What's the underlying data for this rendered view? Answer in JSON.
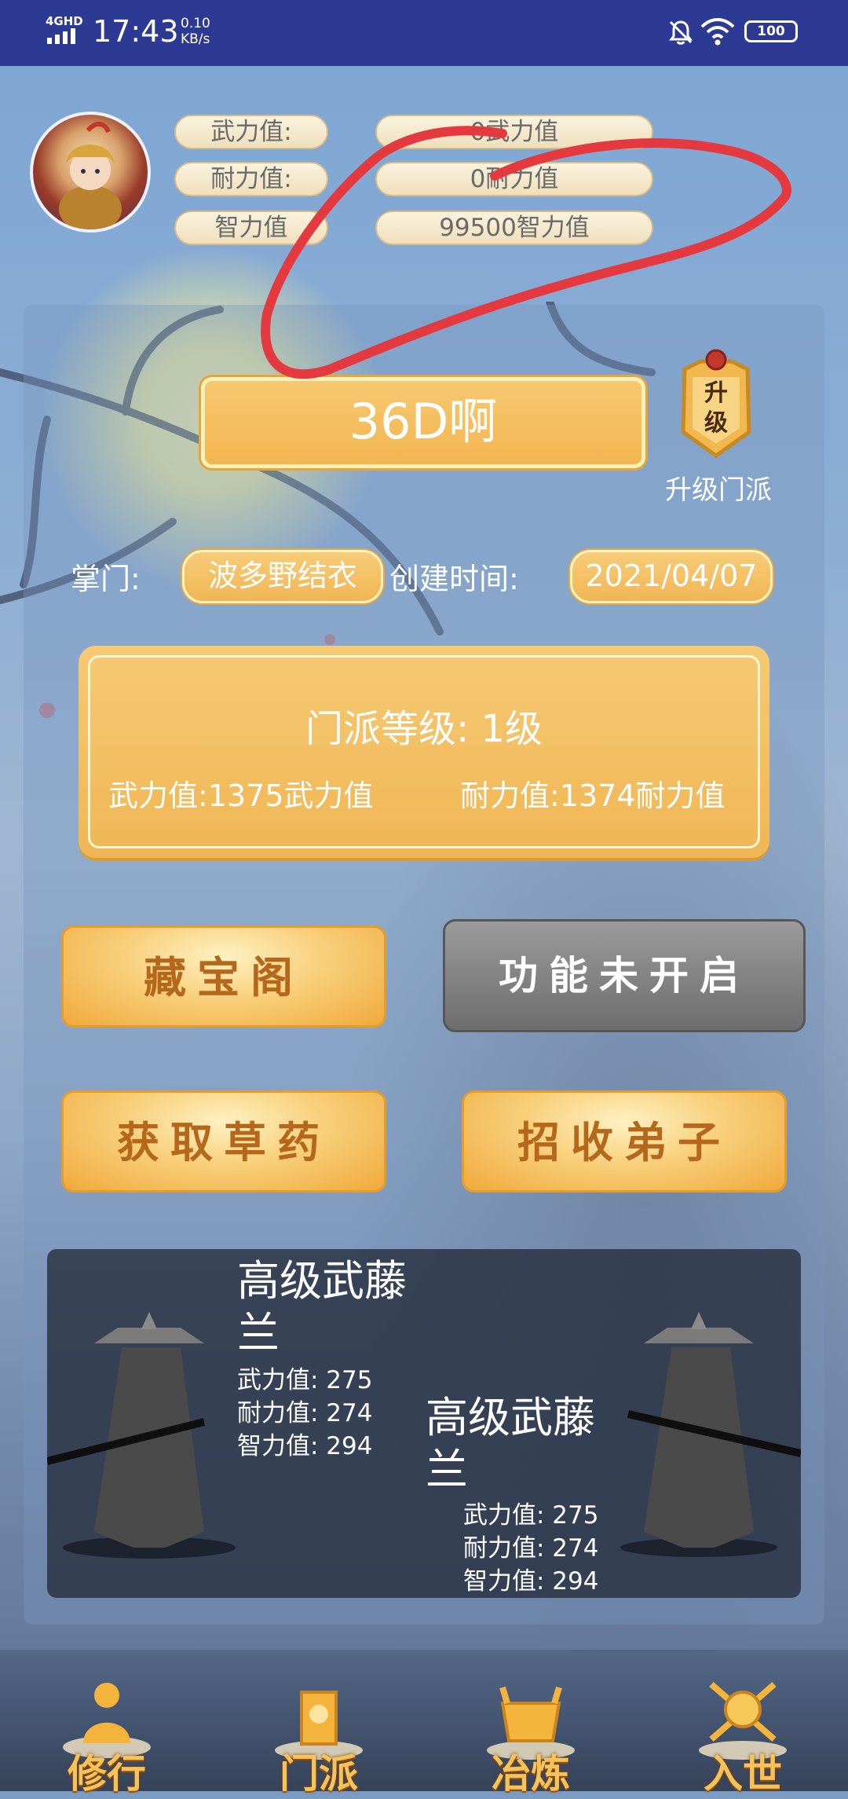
{
  "status_bar": {
    "network": "4GHD",
    "time": "17:43",
    "speed_value": "0.10",
    "speed_unit": "KB/s",
    "battery": "100"
  },
  "stats": {
    "force_label": "武力值:",
    "force_value": "0武力值",
    "endurance_label": "耐力值:",
    "endurance_value": "0耐力值",
    "wisdom_label": "智力值",
    "wisdom_value": "99500智力值"
  },
  "sect": {
    "name": "36D啊",
    "upgrade_badge": "升级",
    "upgrade_label": "升级门派",
    "leader_label": "掌门:",
    "leader_name": "波多野结衣",
    "created_label": "创建时间:",
    "created_date": "2021/04/07",
    "level_text": "门派等级: 1级",
    "force_text": "武力值:1375武力值",
    "endurance_text": "耐力值:1374耐力值"
  },
  "actions": {
    "treasure": "藏宝阁",
    "locked": "功能未开启",
    "herbs": "获取草药",
    "recruit": "招收弟子"
  },
  "disciples": [
    {
      "name": "高级武藤兰",
      "force": "武力值: 275",
      "endurance": "耐力值: 274",
      "wisdom": "智力值: 294"
    },
    {
      "name": "高级武藤兰",
      "force": "武力值: 275",
      "endurance": "耐力值: 274",
      "wisdom": "智力值: 294"
    }
  ],
  "nav": {
    "cultivate": "修行",
    "sect": "门派",
    "smelt": "冶炼",
    "world": "入世"
  },
  "colors": {
    "status_bar": "#2c3a93",
    "gold": "#f2b650",
    "annotation": "#e43a3f"
  }
}
